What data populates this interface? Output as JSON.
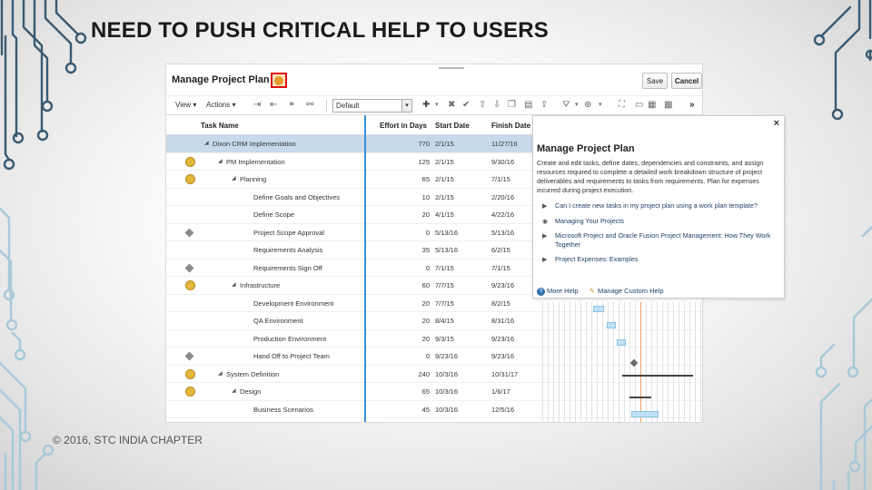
{
  "slide": {
    "title": "NEED TO PUSH CRITICAL HELP TO USERS",
    "footer": "© 2016, STC INDIA CHAPTER"
  },
  "screenshot": {
    "page_heading": "Manage Project Plan",
    "save_label": "Save",
    "cancel_label": "Cancel",
    "toolbar": {
      "view_label": "View",
      "actions_label": "Actions",
      "view_select_value": "Default"
    },
    "columns": {
      "task_name": "Task Name",
      "effort": "Effort in Days",
      "start": "Start Date",
      "finish": "Finish Date"
    },
    "rows": [
      {
        "name": "Dixon CRM Implementation",
        "effort": "770",
        "start": "2/1/15",
        "finish": "11/27/16",
        "icon": "none",
        "selected": true
      },
      {
        "name": "PM Implementation",
        "effort": "125",
        "start": "2/1/15",
        "finish": "9/30/16",
        "icon": "status"
      },
      {
        "name": "Planning",
        "effort": "65",
        "start": "2/1/15",
        "finish": "7/1/15",
        "icon": "status"
      },
      {
        "name": "Define Goals and Objectives",
        "effort": "10",
        "start": "2/1/15",
        "finish": "2/20/16",
        "icon": "none"
      },
      {
        "name": "Define Scope",
        "effort": "20",
        "start": "4/1/15",
        "finish": "4/22/16",
        "icon": "none"
      },
      {
        "name": "Project Scope Approval",
        "effort": "0",
        "start": "5/13/16",
        "finish": "5/13/16",
        "icon": "milestone"
      },
      {
        "name": "Requirements Analysis",
        "effort": "35",
        "start": "5/13/16",
        "finish": "6/2/15",
        "icon": "none"
      },
      {
        "name": "Requirements Sign Off",
        "effort": "0",
        "start": "7/1/15",
        "finish": "7/1/15",
        "icon": "milestone"
      },
      {
        "name": "Infrastructure",
        "effort": "60",
        "start": "7/7/15",
        "finish": "9/23/16",
        "icon": "status"
      },
      {
        "name": "Development Environment",
        "effort": "20",
        "start": "7/7/15",
        "finish": "8/2/15",
        "icon": "none"
      },
      {
        "name": "QA Environment",
        "effort": "20",
        "start": "8/4/15",
        "finish": "8/31/16",
        "icon": "none"
      },
      {
        "name": "Production Environment",
        "effort": "20",
        "start": "9/3/15",
        "finish": "9/23/16",
        "icon": "none"
      },
      {
        "name": "Hand Off to Project Team",
        "effort": "0",
        "start": "9/23/16",
        "finish": "9/23/16",
        "icon": "milestone"
      },
      {
        "name": "System Definition",
        "effort": "240",
        "start": "10/3/16",
        "finish": "10/31/17",
        "icon": "status"
      },
      {
        "name": "Design",
        "effort": "65",
        "start": "10/3/16",
        "finish": "1/6/17",
        "icon": "status"
      },
      {
        "name": "Business Scenarios",
        "effort": "45",
        "start": "10/3/16",
        "finish": "12/5/16",
        "icon": "none"
      }
    ]
  },
  "help_popup": {
    "title": "Manage Project Plan",
    "description": "Create and edit tasks, define dates, dependencies and constraints, and assign resources required to complete a detailed work breakdown structure of project deliverables and requirements to tasks from requirements. Plan for expenses incurred during project execution.",
    "links": [
      {
        "label": "Can I create new tasks in my project plan using a work plan template?",
        "icon": "play-icon"
      },
      {
        "label": "Managing Your Projects",
        "icon": "video-icon"
      },
      {
        "label": "Microsoft Project and Oracle Fusion Project Management: How They Work Together",
        "icon": "play-icon"
      },
      {
        "label": "Project Expenses: Examples",
        "icon": "play-icon"
      }
    ],
    "more_help_label": "More Help",
    "manage_custom_help_label": "Manage Custom Help"
  }
}
